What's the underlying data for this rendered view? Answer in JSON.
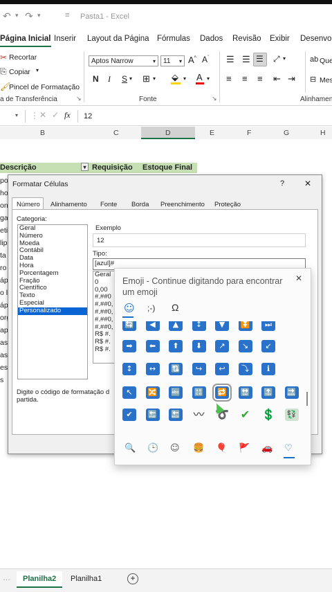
{
  "quick_access": {
    "title": "Pasta1 - Excel"
  },
  "menu": {
    "tabs": [
      "Página Inicial",
      "Inserir",
      "Layout da Página",
      "Fórmulas",
      "Dados",
      "Revisão",
      "Exibir",
      "Desenvolv"
    ]
  },
  "ribbon": {
    "cut": "Recortar",
    "copy": "Copiar",
    "format_painter": "Pincel de Formatação",
    "clipboard_group": "a de Transferência",
    "font_name": "Aptos Narrow",
    "font_size": "11",
    "bold": "N",
    "italic": "I",
    "underline": "S",
    "font_group": "Fonte",
    "alignment_group": "Alinhament",
    "right_label_1": "Que",
    "right_label_2": "Mes"
  },
  "formula_bar": {
    "fx": "fx",
    "value": "12"
  },
  "columns": [
    "B",
    "C",
    "D",
    "E",
    "F",
    "G",
    "H"
  ],
  "sheet": {
    "header_descricao": "Descrição",
    "header_requisicao": "Requisição",
    "header_estoque": "Estoque Final",
    "left_fragments": [
      "po",
      "ho",
      "on",
      "ga",
      "eti",
      "lip",
      "ta",
      "ro",
      "áp",
      "o l",
      "áp",
      "org",
      "ap",
      "as",
      "as",
      "es",
      "s"
    ]
  },
  "dialog": {
    "title": "Formatar Células",
    "help": "?",
    "close": "✕",
    "tabs": [
      "Número",
      "Alinhamento",
      "Fonte",
      "Borda",
      "Preenchimento",
      "Proteção"
    ],
    "category_label": "Categoria:",
    "categories": [
      "Geral",
      "Número",
      "Moeda",
      "Contábil",
      "Data",
      "Hora",
      "Porcentagem",
      "Fração",
      "Científico",
      "Texto",
      "Especial",
      "Personalizado"
    ],
    "selected_category": "Personalizado",
    "sample_label": "Exemplo",
    "sample_value": "12",
    "type_label": "Tipo:",
    "type_value": "[azul]#",
    "type_list": [
      "Geral",
      "0",
      "0,00",
      "#.##0",
      "#.##0,",
      "#.##0,",
      "#.##0,",
      "#.##0,",
      "R$ #.",
      "R$ #.",
      "R$ #."
    ],
    "hint_line1": "Digite o código de formatação d",
    "hint_line2": "partida."
  },
  "emoji_panel": {
    "title": "Emoji - Continue digitando para encontrar um emoji",
    "close": "✕",
    "tab_icons": [
      "smiley-icon",
      "kaomoji-icon",
      "omega-icon"
    ],
    "tab_glyphs": [
      "☺",
      ";-)",
      "Ω"
    ],
    "rows": [
      [
        "🔄",
        "◀",
        "▲",
        "↕",
        "▼",
        "⏬",
        "⏭"
      ],
      [
        "➡",
        "⬅",
        "⬆",
        "⬇",
        "↗",
        "↘",
        "↙"
      ],
      [
        "↕",
        "↔",
        "🔃",
        "↪",
        "↩",
        "⤵",
        "ℹ"
      ],
      [
        "↖",
        "🔀",
        "🔤",
        "🔠",
        "🔁",
        "🔛",
        "🔝",
        "🔜"
      ],
      [
        "✔",
        "🔚",
        "🔙",
        "〰",
        "➰",
        "✔",
        "💲",
        "💱"
      ]
    ],
    "category_icons": [
      "🔍",
      "🕒",
      "☺",
      "🍔",
      "🎈",
      "🚩",
      "🚗",
      "♡"
    ]
  },
  "sheet_tabs": {
    "active": "Planilha2",
    "other": "Planilha1",
    "add": "+"
  },
  "colors": {
    "accent": "#1e7145",
    "header_green": "#c6e0b4",
    "selection": "#0a64d3",
    "emoji_blue": "#2a72c9"
  }
}
